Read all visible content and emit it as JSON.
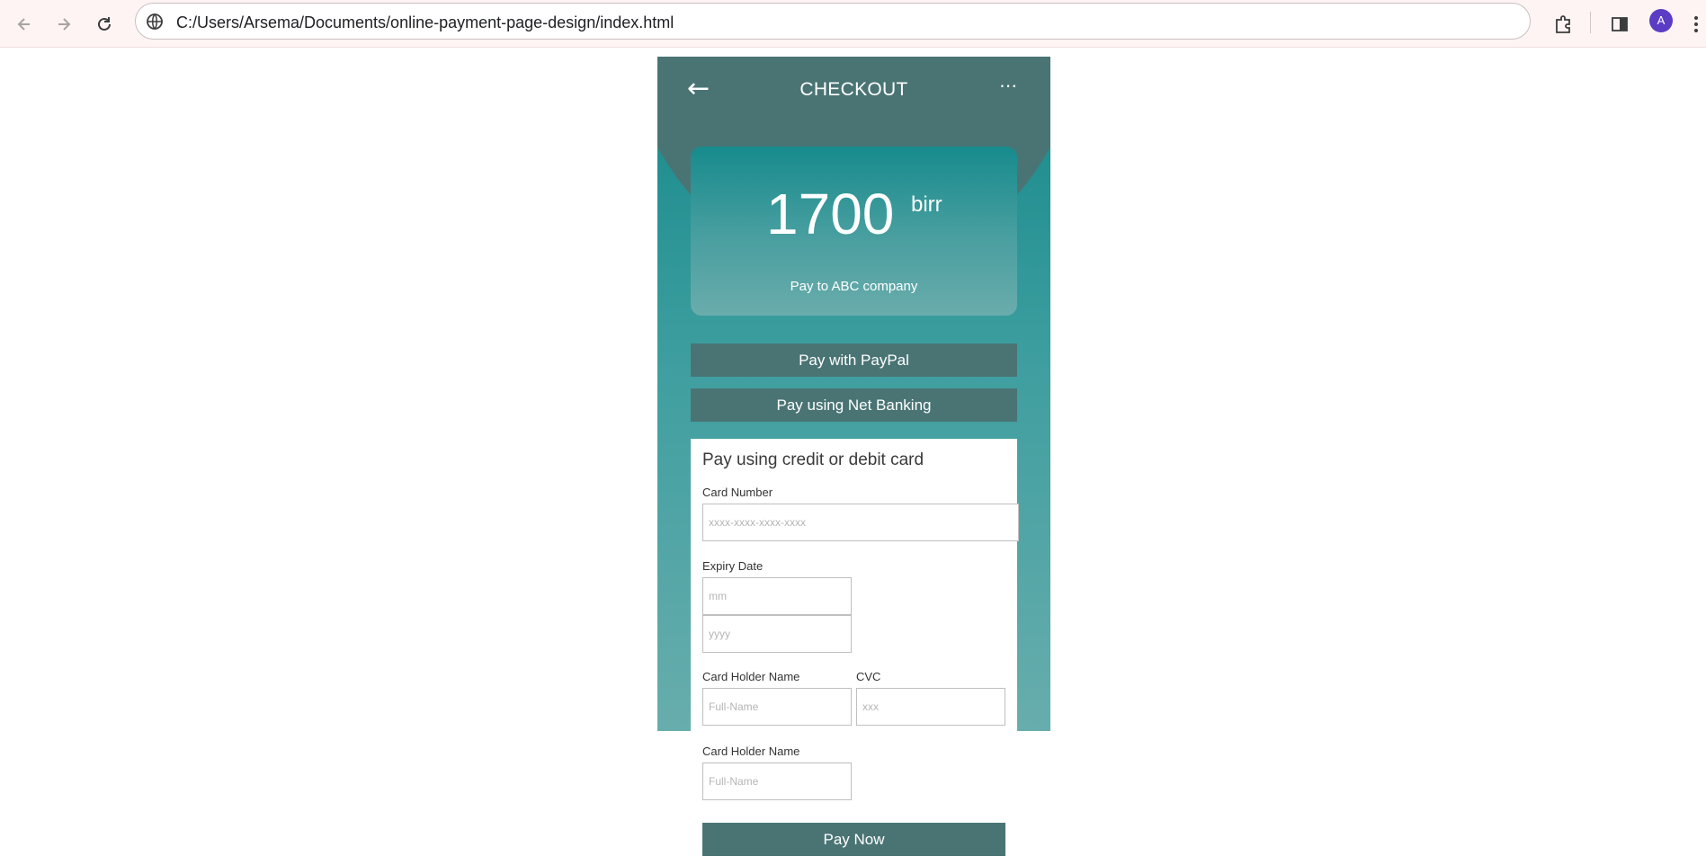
{
  "browser": {
    "url": "C:/Users/Arsema/Documents/online-payment-page-design/index.html",
    "avatar_letter": "A",
    "icons": [
      "back-icon",
      "forward-icon",
      "reload-icon",
      "site-info-icon",
      "extensions-icon",
      "side-panel-icon",
      "menu-icon"
    ]
  },
  "checkout": {
    "title": "CHECKOUT",
    "back_glyph": "←",
    "more_glyph": "⋯",
    "amount": "1700",
    "currency": "birr",
    "pay_to": "Pay to ABC company",
    "paypal_label": "Pay with PayPal",
    "netbanking_label": "Pay using Net Banking"
  },
  "card_form": {
    "heading": "Pay using credit or debit card",
    "card_number_label": "Card Number",
    "card_number_placeholder": "xxxx-xxxx-xxxx-xxxx",
    "expiry_label": "Expiry Date",
    "expiry_month_placeholder": "mm",
    "expiry_year_placeholder": "yyyy",
    "holder_label": "Card Holder Name",
    "holder_placeholder": "Full-Name",
    "cvc_label": "CVC",
    "cvc_placeholder": "xxx",
    "holder2_label": "Card Holder Name",
    "holder2_placeholder": "Full-Name",
    "pay_now_label": "Pay Now"
  },
  "colors": {
    "header": "#4a7474",
    "teal_top": "#14888a",
    "teal_bottom": "#68adad",
    "button": "#4a7474"
  }
}
